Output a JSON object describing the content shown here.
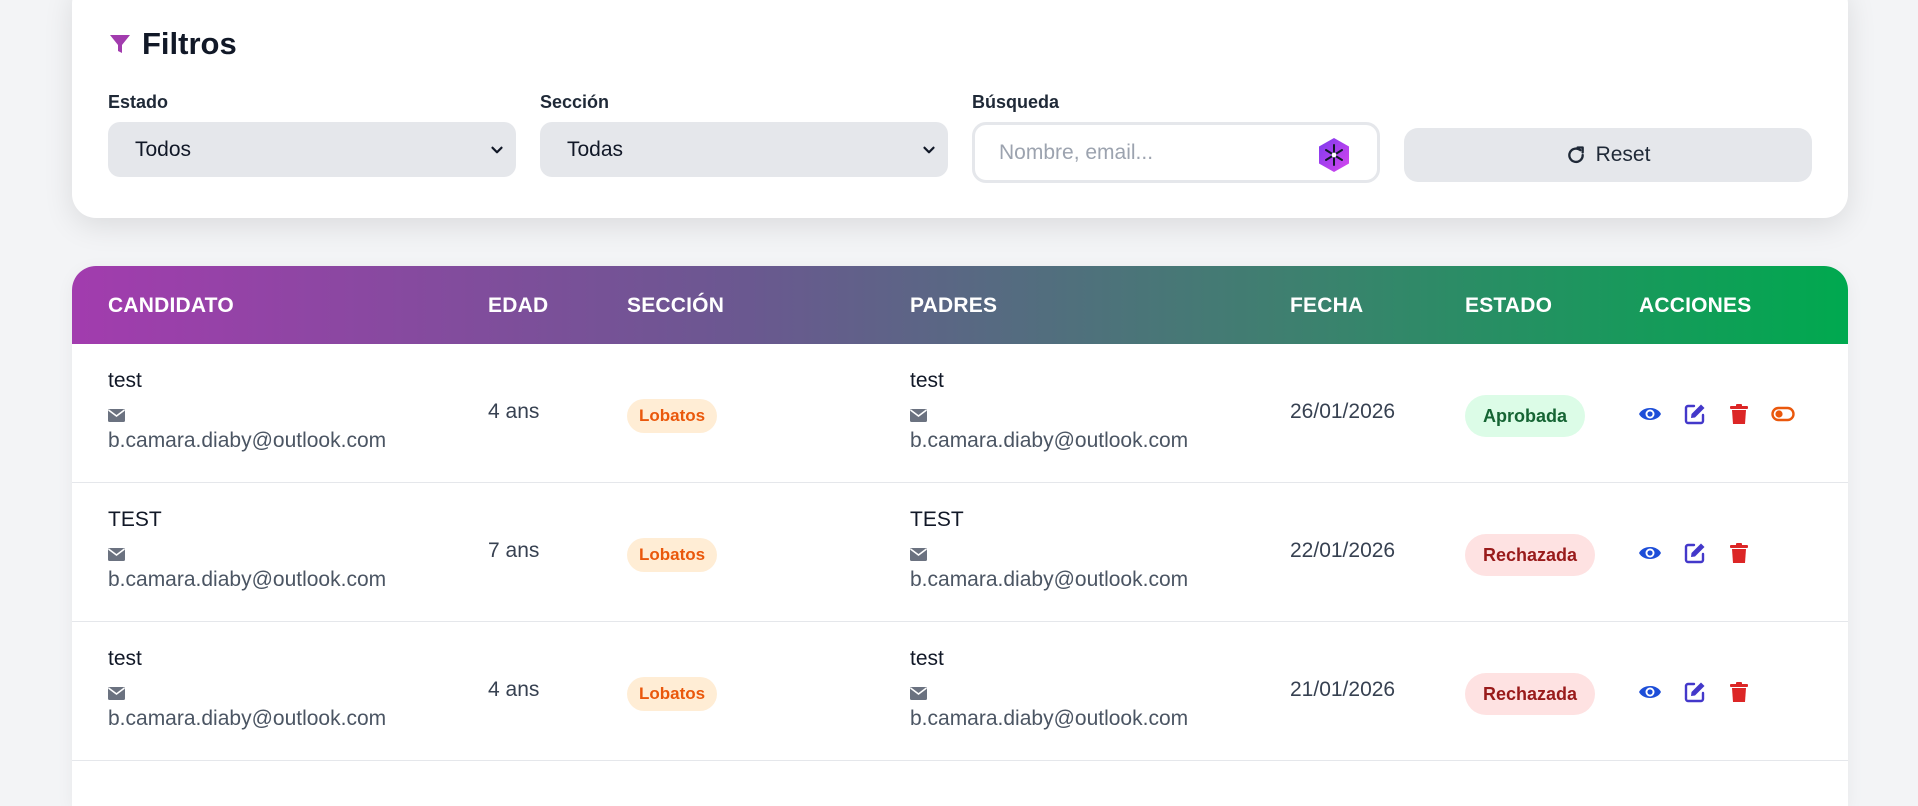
{
  "filters": {
    "title": "Filtros",
    "estado_label": "Estado",
    "estado_value": "Todos",
    "seccion_label": "Sección",
    "seccion_value": "Todas",
    "busqueda_label": "Búsqueda",
    "busqueda_placeholder": "Nombre, email...",
    "reset_label": "Reset"
  },
  "table": {
    "columns": {
      "candidato": "CANDIDATO",
      "edad": "EDAD",
      "seccion": "SECCIÓN",
      "padres": "PADRES",
      "fecha": "FECHA",
      "estado": "ESTADO",
      "acciones": "ACCIONES"
    },
    "rows": [
      {
        "candidate_name": "test",
        "candidate_email": "b.camara.diaby@outlook.com",
        "age": "4 ans",
        "section": "Lobatos",
        "parent_name": "test",
        "parent_email": "b.camara.diaby@outlook.com",
        "date": "26/01/2026",
        "status": "Aprobada"
      },
      {
        "candidate_name": "TEST",
        "candidate_email": "b.camara.diaby@outlook.com",
        "age": "7 ans",
        "section": "Lobatos",
        "parent_name": "TEST",
        "parent_email": "b.camara.diaby@outlook.com",
        "date": "22/01/2026",
        "status": "Rechazada"
      },
      {
        "candidate_name": "test",
        "candidate_email": "b.camara.diaby@outlook.com",
        "age": "4 ans",
        "section": "Lobatos",
        "parent_name": "test",
        "parent_email": "b.camara.diaby@outlook.com",
        "date": "21/01/2026",
        "status": "Rechazada"
      }
    ]
  },
  "colors": {
    "accent_purple": "#a23cae",
    "accent_green": "#00a94f",
    "approved_bg": "#dcfce7",
    "approved_text": "#166534",
    "rejected_bg": "#fee2e2",
    "rejected_text": "#991b1b",
    "view_icon": "#1d4ed8",
    "edit_icon": "#4338ca",
    "delete_icon": "#dc2626",
    "toggle_icon": "#ea580c"
  },
  "icons": {
    "filter": "funnel-icon",
    "chevron": "chevron-down-icon",
    "search_assist": "sparkle-icon",
    "reset": "rotate-icon",
    "email": "envelope-icon",
    "view": "eye-icon",
    "edit": "edit-icon",
    "delete": "trash-icon",
    "toggle": "toggle-icon"
  }
}
